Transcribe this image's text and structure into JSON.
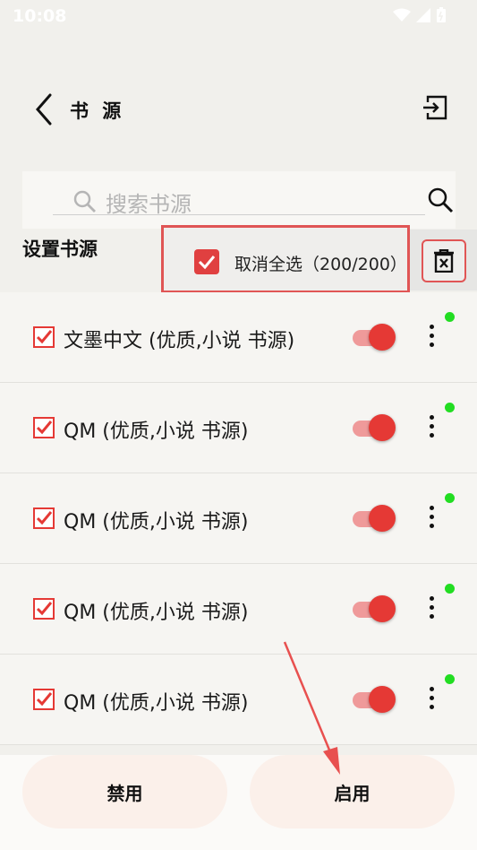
{
  "status_bar": {
    "time": "10:08"
  },
  "header": {
    "title": "书 源"
  },
  "search": {
    "placeholder": "搜索书源"
  },
  "section": {
    "title": "设置书源"
  },
  "selection": {
    "label": "取消全选（200/200）"
  },
  "sources": [
    {
      "name": "文墨中文 (优质,小说 书源)",
      "checked": true,
      "enabled": true
    },
    {
      "name": "QM (优质,小说 书源)",
      "checked": true,
      "enabled": true
    },
    {
      "name": "QM (优质,小说 书源)",
      "checked": true,
      "enabled": true
    },
    {
      "name": "QM (优质,小说 书源)",
      "checked": true,
      "enabled": true
    },
    {
      "name": "QM (优质,小说 书源)",
      "checked": true,
      "enabled": true
    }
  ],
  "bottom": {
    "disable_label": "禁用",
    "enable_label": "启用"
  },
  "colors": {
    "accent": "#e53935",
    "highlight": "#e05555",
    "online_dot": "#22dd22"
  }
}
